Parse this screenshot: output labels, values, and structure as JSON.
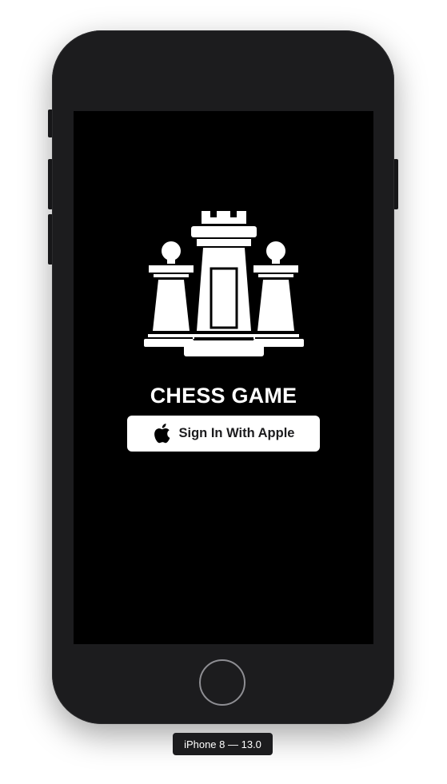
{
  "simulator": {
    "device_label": "iPhone 8 — 13.0"
  },
  "app": {
    "logo_icon": "chess-rooks-pawns-icon",
    "title": "CHESS GAME",
    "sign_in_button": {
      "label": "Sign In With Apple",
      "icon": "apple-logo-icon"
    }
  },
  "colors": {
    "screen_background": "#000000",
    "device_frame": "#1c1c1e",
    "text": "#ffffff",
    "button_background": "#ffffff",
    "button_text": "#1c1c1e"
  }
}
